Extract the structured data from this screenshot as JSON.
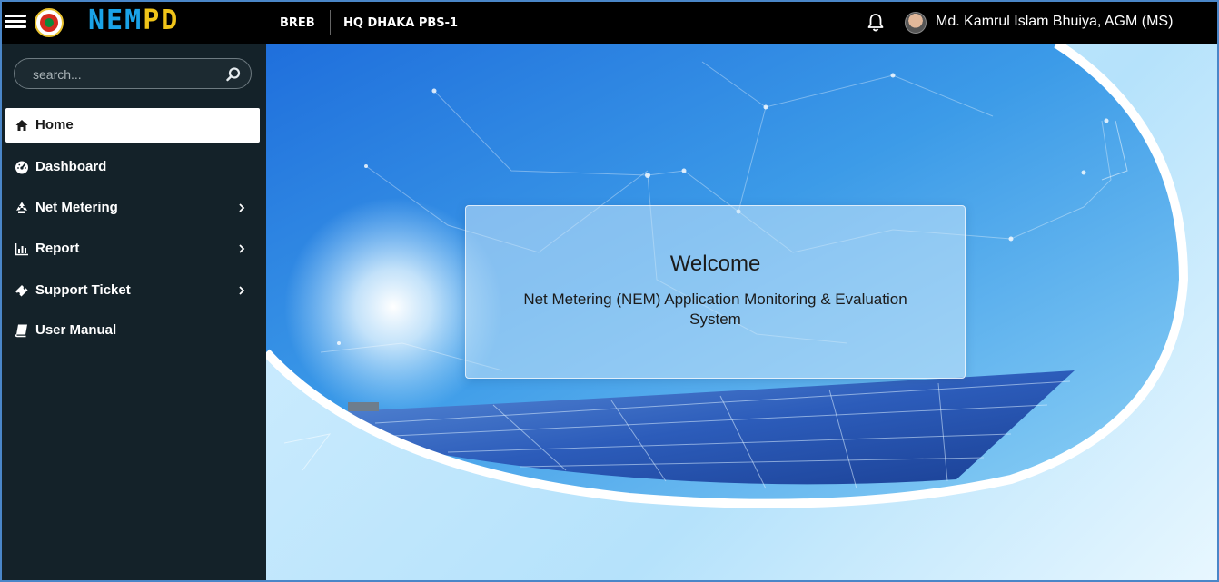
{
  "header": {
    "brand_main": "NEM",
    "brand_accent": "PD",
    "org_label": "BREB",
    "office_label": "HQ DHAKA PBS-1",
    "user_name": "Md. Kamrul Islam Bhuiya, AGM (MS)",
    "notification_icon": "bell-icon",
    "menu_icon": "hamburger-icon"
  },
  "sidebar": {
    "search_placeholder": "search...",
    "search_icon": "search-icon",
    "items": [
      {
        "label": "Home",
        "icon": "home-icon",
        "active": true,
        "has_submenu": false
      },
      {
        "label": "Dashboard",
        "icon": "tachometer-icon",
        "active": false,
        "has_submenu": false
      },
      {
        "label": "Net Metering",
        "icon": "recycle-icon",
        "active": false,
        "has_submenu": true
      },
      {
        "label": "Report",
        "icon": "bar-chart-icon",
        "active": false,
        "has_submenu": true
      },
      {
        "label": "Support Ticket",
        "icon": "ticket-icon",
        "active": false,
        "has_submenu": true
      },
      {
        "label": "User Manual",
        "icon": "book-icon",
        "active": false,
        "has_submenu": false
      }
    ]
  },
  "main": {
    "welcome_title": "Welcome",
    "welcome_subtitle": "Net Metering (NEM) Application Monitoring & Evaluation System"
  },
  "colors": {
    "topbar": "#000000",
    "sidebar": "#142229",
    "brand_blue": "#1aa3e8",
    "brand_yellow": "#f0c419",
    "hero_sky": "#3a95e8"
  }
}
